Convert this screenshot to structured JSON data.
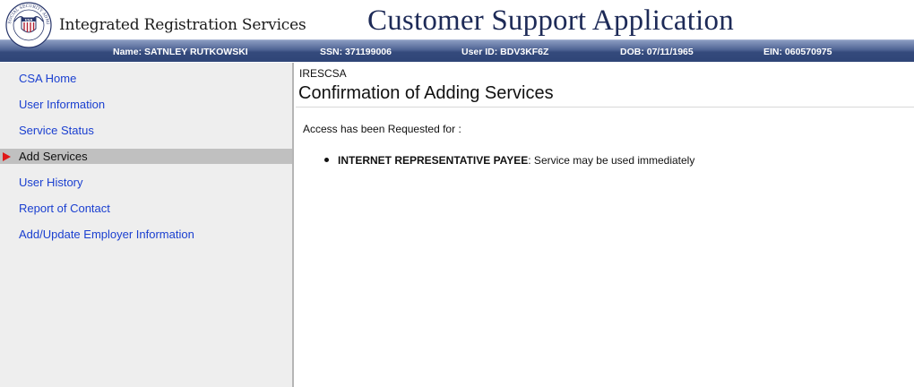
{
  "header": {
    "brand": "Integrated Registration Services",
    "app_title": "Customer Support Application",
    "seal_text": "SOCIAL SECURITY ADMINISTRATION",
    "seal_abbrev": "USA"
  },
  "userbar": {
    "name": "Name: SATNLEY RUTKOWSKI",
    "ssn": "SSN: 371199006",
    "user_id": "User ID: BDV3KF6Z",
    "dob": "DOB: 07/11/1965",
    "ein": "EIN: 060570975"
  },
  "sidebar": {
    "items": [
      {
        "label": "CSA Home"
      },
      {
        "label": "User Information"
      },
      {
        "label": "Service Status"
      },
      {
        "label": "Add Services",
        "active": true
      },
      {
        "label": "User History"
      },
      {
        "label": "Report of Contact"
      },
      {
        "label": "Add/Update Employer Information"
      }
    ],
    "active_marker_color": "#e01818",
    "link_color": "#1a3fd0"
  },
  "main": {
    "crumb": "IRESCSA",
    "title": "Confirmation of Adding Services",
    "intro": "Access has been Requested for :",
    "services": [
      {
        "name": "INTERNET REPRESENTATIVE PAYEE",
        "status": ": Service may be used immediately"
      }
    ]
  },
  "colors": {
    "header_title": "#1d2a57",
    "userbar_bg": "#3b5183"
  }
}
